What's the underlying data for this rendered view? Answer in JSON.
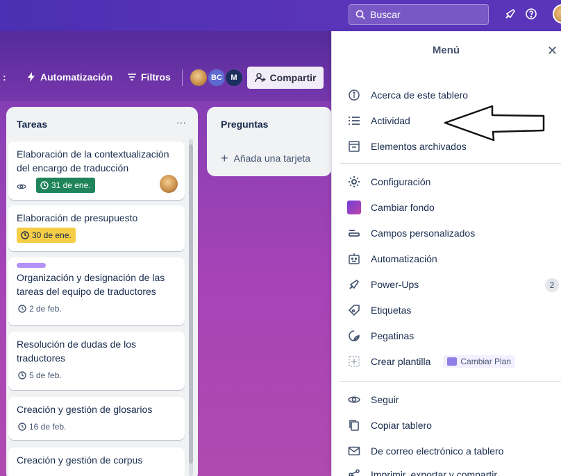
{
  "topbar": {
    "search_placeholder": "Buscar"
  },
  "header": {
    "automation": "Automatización",
    "filters": "Filtros",
    "share": "Compartir",
    "members": [
      "BC",
      "M"
    ]
  },
  "lists": [
    {
      "title": "Tareas",
      "more": "···",
      "cards": [
        {
          "title": "Elaboración de la contextualización del encargo de traducción",
          "due": "31 de ene.",
          "due_style": "green"
        },
        {
          "title": "Elaboración de presupuesto",
          "due": "30 de ene.",
          "due_style": "yellow"
        },
        {
          "title": "Organización y designación de las tareas del equipo de traductores",
          "due": "2 de feb.",
          "due_style": "plain",
          "label_color": "#b391f6"
        },
        {
          "title": "Resolución de dudas de los traductores",
          "due": "5 de feb.",
          "due_style": "plain"
        },
        {
          "title": "Creación y gestión de glosarios",
          "due": "16 de feb.",
          "due_style": "plain"
        },
        {
          "title": "Creación y gestión de corpus",
          "due": "",
          "due_style": "plain"
        }
      ]
    },
    {
      "title": "Preguntas",
      "add_card": "Añada una tarjeta"
    }
  ],
  "menu": {
    "title": "Menú",
    "group1": [
      {
        "label": "Acerca de este tablero",
        "icon": "info-icon"
      },
      {
        "label": "Actividad",
        "icon": "activity-icon"
      },
      {
        "label": "Elementos archivados",
        "icon": "archive-icon"
      }
    ],
    "group2": [
      {
        "label": "Configuración",
        "icon": "gear-icon"
      },
      {
        "label": "Cambiar fondo",
        "icon": "background-swatch-icon"
      },
      {
        "label": "Campos personalizados",
        "icon": "custom-fields-icon"
      },
      {
        "label": "Automatización",
        "icon": "automation-icon"
      },
      {
        "label": "Power-Ups",
        "icon": "rocket-icon",
        "count": "2"
      },
      {
        "label": "Etiquetas",
        "icon": "tag-icon"
      },
      {
        "label": "Pegatinas",
        "icon": "sticker-icon"
      },
      {
        "label": "Crear plantilla",
        "icon": "template-icon",
        "chip": "Cambiar Plan"
      }
    ],
    "group3": [
      {
        "label": "Seguir",
        "icon": "eye-icon"
      },
      {
        "label": "Copiar tablero",
        "icon": "copy-icon"
      },
      {
        "label": "De correo electrónico a tablero",
        "icon": "mail-icon"
      },
      {
        "label": "Imprimir, exportar y compartir",
        "icon": "share-icon"
      }
    ]
  },
  "colors": {
    "accent": "#5a34b9",
    "due_green": "#1f845a",
    "due_yellow": "#f5cd47"
  }
}
